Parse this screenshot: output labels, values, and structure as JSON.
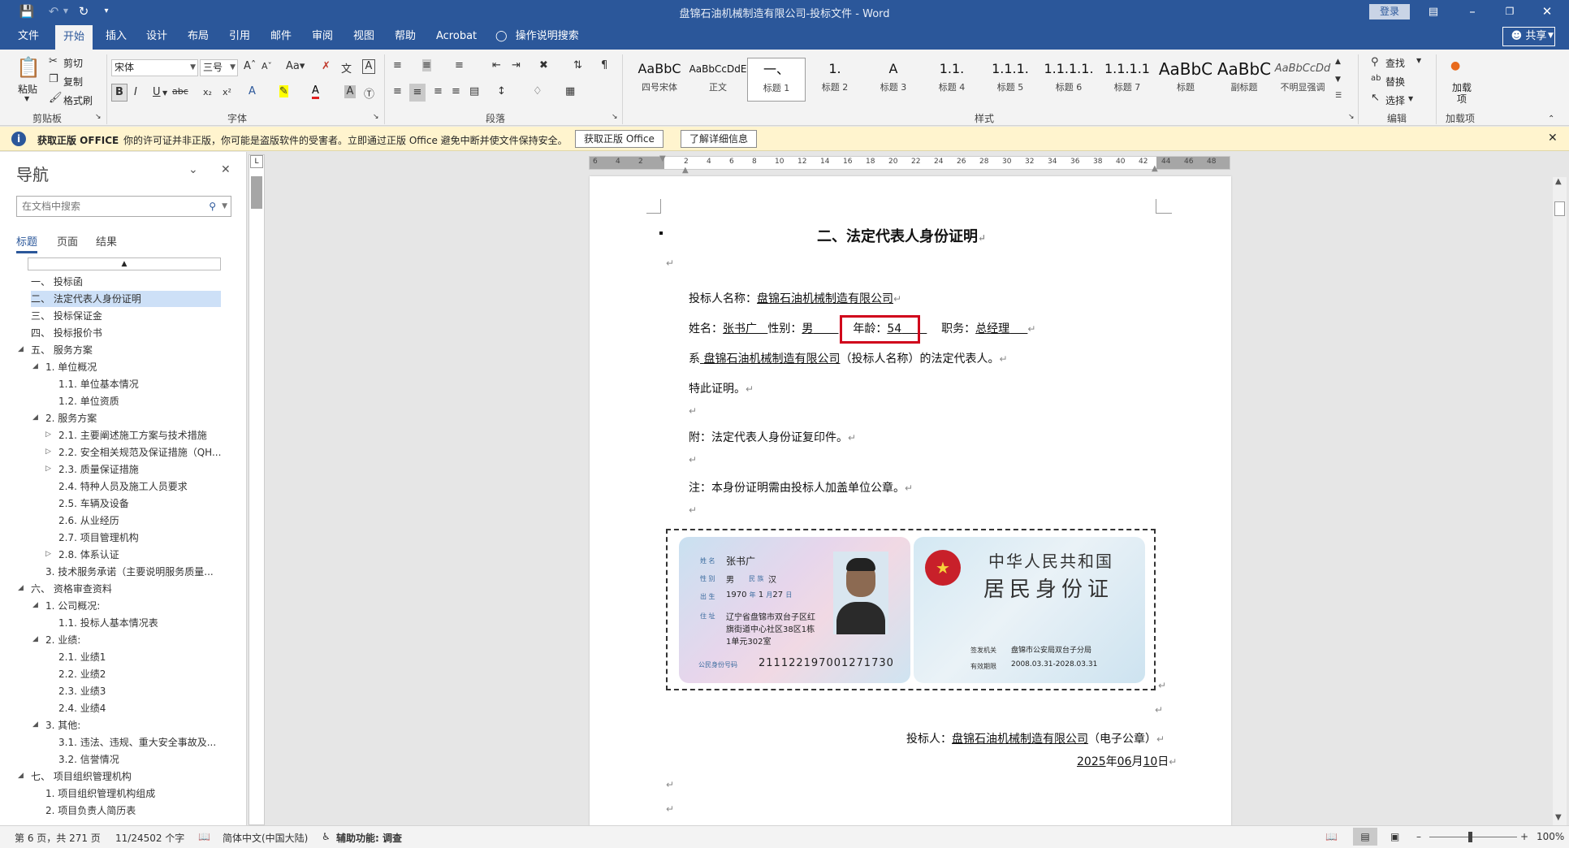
{
  "window": {
    "title": "盘锦石油机械制造有限公司-投标文件 - Word",
    "login_label": "登录",
    "share_label": "共享"
  },
  "menu_tabs": [
    "文件",
    "开始",
    "插入",
    "设计",
    "布局",
    "引用",
    "邮件",
    "审阅",
    "视图",
    "帮助",
    "Acrobat"
  ],
  "tell_me": "操作说明搜索",
  "ribbon": {
    "clipboard": {
      "paste": "粘贴",
      "cut": "剪切",
      "copy": "复制",
      "format_painter": "格式刷",
      "label": "剪贴板"
    },
    "font": {
      "name": "宋体",
      "size": "三号",
      "label": "字体"
    },
    "paragraph": {
      "label": "段落"
    },
    "styles": {
      "label": "样式",
      "items": [
        {
          "sample": "AaBbC",
          "name": "四号宋体"
        },
        {
          "sample": "AaBbCcDdE",
          "name": "正文"
        },
        {
          "sample": "一、",
          "name": "标题 1"
        },
        {
          "sample": "1.",
          "name": "标题 2"
        },
        {
          "sample": "A",
          "name": "标题 3"
        },
        {
          "sample": "1.1.",
          "name": "标题 4"
        },
        {
          "sample": "1.1.1.",
          "name": "标题 5"
        },
        {
          "sample": "1.1.1.1.",
          "name": "标题 6"
        },
        {
          "sample": "1.1.1.1",
          "name": "标题 7"
        },
        {
          "sample": "AaBbC",
          "name": "标题"
        },
        {
          "sample": "AaBbC",
          "name": "副标题"
        },
        {
          "sample": "AaBbCcDd",
          "name": "不明显强调"
        }
      ]
    },
    "editing": {
      "find": "查找",
      "replace": "替换",
      "select": "选择",
      "label": "编辑"
    },
    "addins": {
      "name": "加载项",
      "label": "加载项"
    }
  },
  "infobar": {
    "title": "获取正版 OFFICE",
    "message": "你的许可证并非正版，你可能是盗版软件的受害者。立即通过正版 Office 避免中断并使文件保持安全。",
    "btn_get": "获取正版 Office",
    "btn_more": "了解详细信息"
  },
  "nav": {
    "title": "导航",
    "search_placeholder": "在文档中搜索",
    "tabs": [
      "标题",
      "页面",
      "结果"
    ],
    "items": [
      {
        "text": "一、 投标函",
        "level": 0,
        "expand": ""
      },
      {
        "text": "二、 法定代表人身份证明",
        "level": 0,
        "expand": "",
        "selected": true
      },
      {
        "text": "三、 投标保证金",
        "level": 0,
        "expand": ""
      },
      {
        "text": "四、 投标报价书",
        "level": 0,
        "expand": ""
      },
      {
        "text": "五、 服务方案",
        "level": 0,
        "expand": "▲"
      },
      {
        "text": "1. 单位概况",
        "level": 1,
        "expand": "▲"
      },
      {
        "text": "1.1. 单位基本情况",
        "level": 2,
        "expand": ""
      },
      {
        "text": "1.2. 单位资质",
        "level": 2,
        "expand": ""
      },
      {
        "text": "2. 服务方案",
        "level": 1,
        "expand": "▲"
      },
      {
        "text": "2.1. 主要阐述施工方案与技术措施",
        "level": 2,
        "expand": "▷"
      },
      {
        "text": "2.2. 安全相关规范及保证措施（QH...",
        "level": 2,
        "expand": "▷"
      },
      {
        "text": "2.3. 质量保证措施",
        "level": 2,
        "expand": "▷"
      },
      {
        "text": "2.4. 特种人员及施工人员要求",
        "level": 2,
        "expand": ""
      },
      {
        "text": "2.5. 车辆及设备",
        "level": 2,
        "expand": ""
      },
      {
        "text": "2.6. 从业经历",
        "level": 2,
        "expand": ""
      },
      {
        "text": "2.7. 项目管理机构",
        "level": 2,
        "expand": ""
      },
      {
        "text": "2.8. 体系认证",
        "level": 2,
        "expand": "▷"
      },
      {
        "text": "3. 技术服务承诺（主要说明服务质量...",
        "level": 1,
        "expand": ""
      },
      {
        "text": "六、 资格审查资料",
        "level": 0,
        "expand": "▲"
      },
      {
        "text": "1. 公司概况:",
        "level": 1,
        "expand": "▲"
      },
      {
        "text": "1.1. 投标人基本情况表",
        "level": 2,
        "expand": ""
      },
      {
        "text": "2. 业绩:",
        "level": 1,
        "expand": "▲"
      },
      {
        "text": "2.1. 业绩1",
        "level": 2,
        "expand": ""
      },
      {
        "text": "2.2. 业绩2",
        "level": 2,
        "expand": ""
      },
      {
        "text": "2.3. 业绩3",
        "level": 2,
        "expand": ""
      },
      {
        "text": "2.4. 业绩4",
        "level": 2,
        "expand": ""
      },
      {
        "text": "3. 其他:",
        "level": 1,
        "expand": "▲"
      },
      {
        "text": "3.1. 违法、违规、重大安全事故及...",
        "level": 2,
        "expand": ""
      },
      {
        "text": "3.2. 信誉情况",
        "level": 2,
        "expand": ""
      },
      {
        "text": "七、 项目组织管理机构",
        "level": 0,
        "expand": "▲"
      },
      {
        "text": "1. 项目组织管理机构组成",
        "level": 1,
        "expand": ""
      },
      {
        "text": "2. 项目负责人简历表",
        "level": 1,
        "expand": ""
      }
    ]
  },
  "ruler_numbers": [
    "6",
    "4",
    "2",
    "",
    "2",
    "4",
    "6",
    "8",
    "10",
    "12",
    "14",
    "16",
    "18",
    "20",
    "22",
    "24",
    "26",
    "28",
    "30",
    "32",
    "34",
    "36",
    "38",
    "40",
    "42",
    "44",
    "46",
    "48"
  ],
  "document": {
    "heading": "二、法定代表人身份证明",
    "bidder_label": "投标人名称：",
    "bidder_name": "盘锦石油机械制造有限公司",
    "name_label": "姓名：",
    "name_value": "张书广",
    "gender_label": "性别：",
    "gender_value": "男",
    "age_label": "年龄：",
    "age_value": "54",
    "title_label": "职务：",
    "title_value": "总经理",
    "line3_prefix": "系",
    "line3_company": "盘锦石油机械制造有限公司",
    "line3_suffix": "（投标人名称）的法定代表人。",
    "line4": "特此证明。",
    "line5": "附：法定代表人身份证复印件。",
    "line6": "注：本身份证明需由投标人加盖单位公章。",
    "sign_label": "投标人：",
    "sign_company": "盘锦石油机械制造有限公司",
    "sign_suffix": "（电子公章）",
    "date_year": "2025",
    "date_y": "年",
    "date_month": "06",
    "date_m": "月",
    "date_day": "10",
    "date_d": "日"
  },
  "id_card": {
    "front": {
      "name_label": "姓 名",
      "name": "张书广",
      "sex_label": "性 别",
      "sex": "男",
      "nation_label": "民 族",
      "nation": "汉",
      "birth_label": "出 生",
      "birth_year": "1970",
      "birth_y": "年",
      "birth_month": "1",
      "birth_m": "月",
      "birth_day": "27",
      "birth_d": "日",
      "addr_label": "住 址",
      "addr1": "辽宁省盘锦市双台子区红",
      "addr2": "旗街道中心社区38区1栋",
      "addr3": "1单元302室",
      "id_label": "公民身份号码",
      "id_number": "211122197001271730"
    },
    "back": {
      "country": "中华人民共和国",
      "card_title": "居民身份证",
      "authority_label": "签发机关",
      "authority": "盘锦市公安局双台子分局",
      "valid_label": "有效期限",
      "valid": "2008.03.31-2028.03.31"
    }
  },
  "status": {
    "page": "第 6 页，共 271 页",
    "words": "11/24502 个字",
    "language": "简体中文(中国大陆)",
    "accessibility": "辅助功能: 调查",
    "zoom": "100%"
  }
}
